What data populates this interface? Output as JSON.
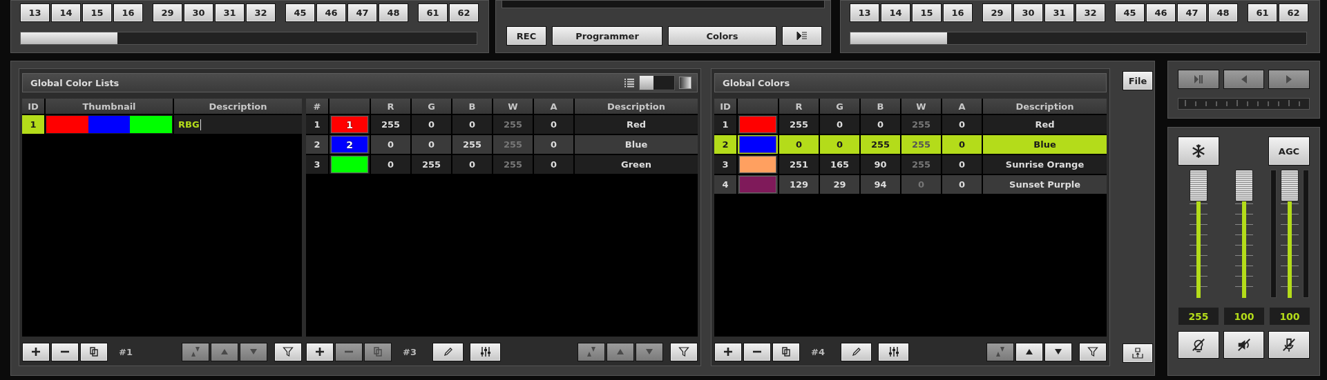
{
  "top_left": {
    "button_groups": [
      [
        "13",
        "14",
        "15",
        "16"
      ],
      [
        "29",
        "30",
        "31",
        "32"
      ],
      [
        "45",
        "46",
        "47",
        "48"
      ],
      [
        "61",
        "62"
      ]
    ]
  },
  "top_center": {
    "buttons": [
      {
        "kind": "text",
        "label": "REC"
      },
      {
        "kind": "text",
        "label": "Programmer"
      },
      {
        "kind": "text",
        "label": "Colors"
      },
      {
        "kind": "list-arrow"
      }
    ]
  },
  "top_right": {
    "button_groups": [
      [
        "13",
        "14",
        "15",
        "16"
      ],
      [
        "29",
        "30",
        "31",
        "32"
      ],
      [
        "45",
        "46",
        "47",
        "48"
      ],
      [
        "61",
        "62"
      ]
    ]
  },
  "color_lists": {
    "title": "Global Color Lists",
    "view_toggle": {
      "on": false
    },
    "columns": [
      {
        "kind": "index",
        "label": "ID"
      },
      {
        "kind": "thumbnail",
        "label": "Thumbnail"
      },
      {
        "kind": "description",
        "label": "Description"
      }
    ],
    "rows": [
      {
        "index": "1",
        "swatches": [
          {
            "color": "#ff0000"
          },
          {
            "color": "#0000ff"
          },
          {
            "color": "#00ff00"
          }
        ],
        "description": "RBG",
        "selected": true,
        "editing": true
      }
    ],
    "toolbar": {
      "count": "#1",
      "list_buttons": [
        {
          "kind": "add",
          "disabled": false
        },
        {
          "kind": "remove",
          "disabled": false
        },
        {
          "kind": "copy",
          "disabled": false
        }
      ],
      "order_buttons": [
        {
          "kind": "move",
          "disabled": true
        },
        {
          "kind": "up",
          "disabled": true
        },
        {
          "kind": "down",
          "disabled": true
        }
      ],
      "filter_button": {
        "kind": "filter",
        "disabled": false
      }
    }
  },
  "list_entries": {
    "columns": [
      {
        "kind": "index",
        "label": "#"
      },
      {
        "kind": "swatch"
      },
      {
        "kind": "value",
        "label": "R",
        "dimmed": false
      },
      {
        "kind": "value",
        "label": "G",
        "dimmed": false
      },
      {
        "kind": "value",
        "label": "B",
        "dimmed": false
      },
      {
        "kind": "value",
        "label": "W",
        "dimmed": true
      },
      {
        "kind": "value",
        "label": "A",
        "dimmed": false
      },
      {
        "kind": "description",
        "label": "Description"
      }
    ],
    "rows": [
      {
        "index": "1",
        "color": "#ff0000",
        "swatch_label": "1",
        "values": [
          "255",
          "0",
          "0",
          "255",
          "0"
        ],
        "description": "Red",
        "selected": false
      },
      {
        "index": "2",
        "color": "#0000ff",
        "swatch_label": "2",
        "values": [
          "0",
          "0",
          "255",
          "255",
          "0"
        ],
        "description": "Blue",
        "selected": false
      },
      {
        "index": "3",
        "color": "#00ff00",
        "values": [
          "0",
          "255",
          "0",
          "255",
          "0"
        ],
        "description": "Green",
        "selected": false
      }
    ],
    "toolbar": {
      "count": "#3",
      "list_buttons": [
        {
          "kind": "add",
          "disabled": false
        },
        {
          "kind": "remove",
          "disabled": true
        },
        {
          "kind": "copy",
          "disabled": true
        }
      ],
      "tool_buttons": [
        {
          "kind": "edit",
          "disabled": false
        },
        {
          "kind": "mixer",
          "disabled": false
        }
      ],
      "order_buttons": [
        {
          "kind": "move",
          "disabled": true
        },
        {
          "kind": "up",
          "disabled": true
        },
        {
          "kind": "down",
          "disabled": true
        }
      ],
      "filter_button": {
        "kind": "filter",
        "disabled": false
      }
    }
  },
  "global_colors": {
    "title": "Global Colors",
    "columns": [
      {
        "kind": "index",
        "label": "ID"
      },
      {
        "kind": "swatch"
      },
      {
        "kind": "value",
        "label": "R",
        "dimmed": false
      },
      {
        "kind": "value",
        "label": "G",
        "dimmed": false
      },
      {
        "kind": "value",
        "label": "B",
        "dimmed": false
      },
      {
        "kind": "value",
        "label": "W",
        "dimmed": true
      },
      {
        "kind": "value",
        "label": "A",
        "dimmed": false
      },
      {
        "kind": "description",
        "label": "Description"
      }
    ],
    "rows": [
      {
        "index": "1",
        "color": "#ff0000",
        "values": [
          "255",
          "0",
          "0",
          "255",
          "0"
        ],
        "description": "Red",
        "selected": false
      },
      {
        "index": "2",
        "color": "#0000ff",
        "values": [
          "0",
          "0",
          "255",
          "255",
          "0"
        ],
        "description": "Blue",
        "selected": true
      },
      {
        "index": "3",
        "color": "#ffa060",
        "values": [
          "251",
          "165",
          "90",
          "255",
          "0"
        ],
        "description": "Sunrise Orange",
        "selected": false
      },
      {
        "index": "4",
        "color": "#7f1a5a",
        "values": [
          "129",
          "29",
          "94",
          "0",
          "0"
        ],
        "description": "Sunset Purple",
        "selected": false
      }
    ],
    "toolbar": {
      "count": "#4",
      "list_buttons": [
        {
          "kind": "add",
          "disabled": false
        },
        {
          "kind": "remove",
          "disabled": false
        },
        {
          "kind": "copy",
          "disabled": false
        }
      ],
      "tool_buttons": [
        {
          "kind": "edit",
          "disabled": false
        },
        {
          "kind": "mixer",
          "disabled": false
        }
      ],
      "order_buttons": [
        {
          "kind": "move",
          "disabled": true
        },
        {
          "kind": "up",
          "disabled": false
        },
        {
          "kind": "down",
          "disabled": false
        }
      ],
      "filter_button": {
        "kind": "filter",
        "disabled": false
      }
    }
  },
  "file_button": {
    "label": "File"
  },
  "player": {
    "buttons": [
      {
        "kind": "play-pause",
        "disabled": true
      },
      {
        "kind": "prev",
        "disabled": true
      },
      {
        "kind": "next",
        "disabled": true
      }
    ]
  },
  "master": {
    "top_buttons": [
      {
        "kind": "freeze"
      },
      {
        "kind": "text",
        "label": "AGC"
      }
    ],
    "faders": [
      {
        "level": 1,
        "reading": "255",
        "meter": false
      },
      {
        "level": 1,
        "reading": "100",
        "meter": false
      },
      {
        "level": 1,
        "reading": "100",
        "meter": true
      }
    ],
    "bottom_buttons": [
      {
        "kind": "light-off"
      },
      {
        "kind": "mute"
      },
      {
        "kind": "mic-off"
      }
    ]
  }
}
